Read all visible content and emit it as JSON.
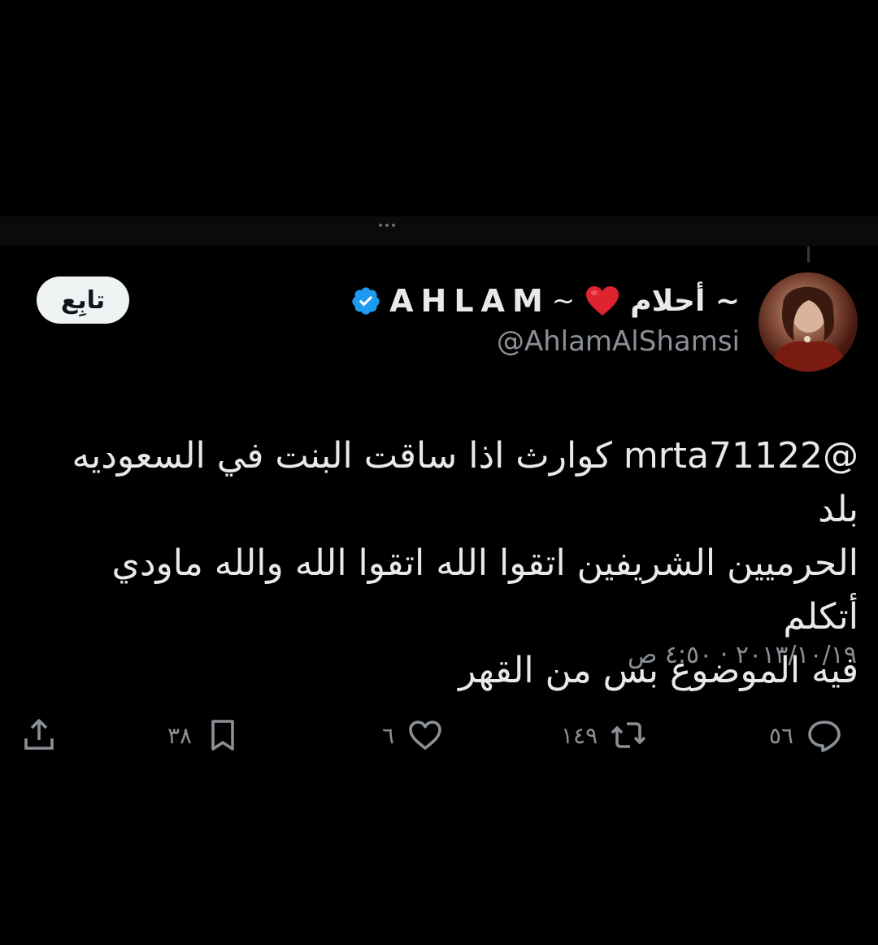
{
  "tweet": {
    "author": {
      "display_name_arabic": "أحلام ~",
      "display_name_heart": "❤️",
      "display_name_tilde": "~",
      "display_name_latin": "AHLAM",
      "handle": "@AhlamAlShamsi",
      "verified": true
    },
    "follow_label": "تابِع",
    "text_lines": [
      "@mrta71122 كوارث اذا ساقت البنت في السعوديه بلد",
      "الحرميين الشريفين اتقوا الله اتقوا الله والله ماودي أتكلم",
      "فيه الموضوع بس من القهر"
    ],
    "timestamp": "٢٠١٣/١٠/١٩ · ٤:٥٠ ص",
    "actions": {
      "replies": "٥٦",
      "retweets": "١٤٩",
      "likes": "٦",
      "bookmarks": "٣٨"
    }
  },
  "colors": {
    "background": "#000000",
    "text_primary": "#e7e9ea",
    "text_secondary": "#8b9096",
    "verified_blue": "#1d9bf0",
    "heart_red": "#e0242f",
    "follow_button_bg": "#eff3f4"
  },
  "icons": {
    "reply": "reply-icon",
    "retweet": "retweet-icon",
    "like": "heart-icon",
    "bookmark": "bookmark-icon",
    "share": "share-icon",
    "verified": "verified-badge-icon"
  }
}
